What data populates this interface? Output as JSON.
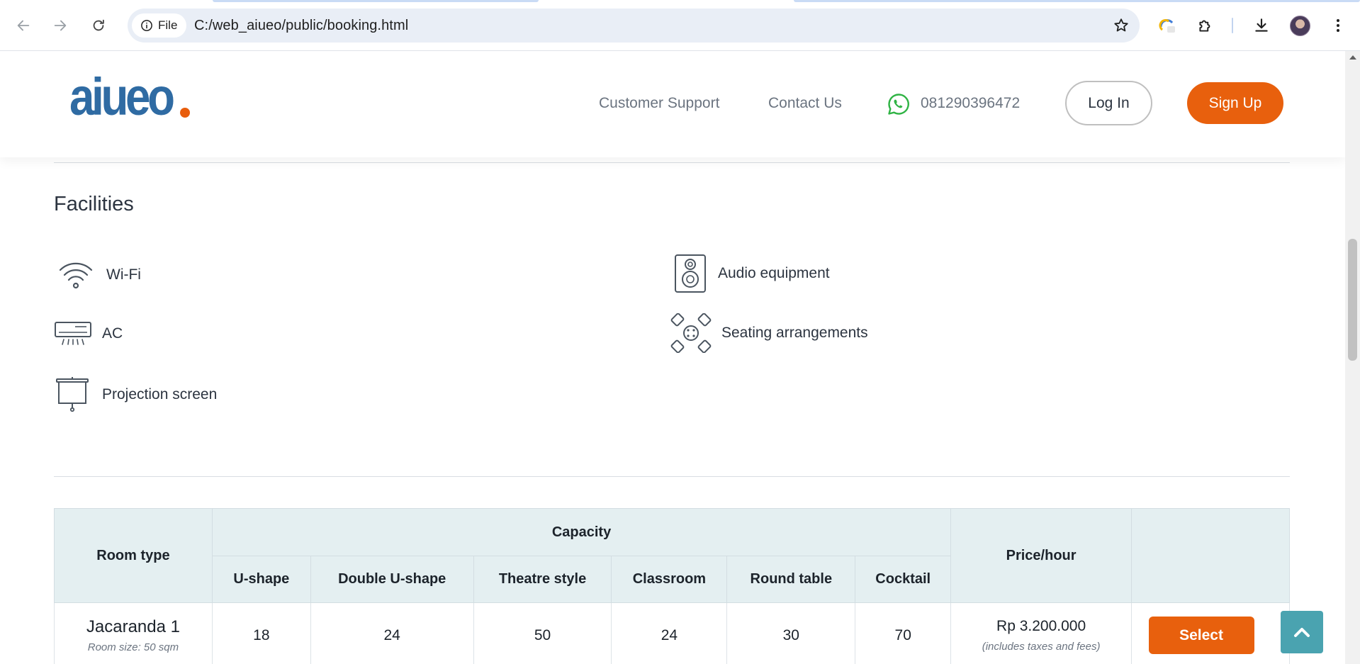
{
  "browser": {
    "file_chip": "File",
    "url": "C:/web_aiueo/public/booking.html"
  },
  "header": {
    "logo_text": "aiueo",
    "nav": {
      "customer_support": "Customer Support",
      "contact_us": "Contact Us"
    },
    "phone": "081290396472",
    "login_label": "Log In",
    "signup_label": "Sign Up"
  },
  "facilities": {
    "title": "Facilities",
    "items": [
      {
        "label": "Wi-Fi",
        "icon": "wifi-icon"
      },
      {
        "label": "AC",
        "icon": "air-conditioner-icon"
      },
      {
        "label": "Projection screen",
        "icon": "projection-screen-icon"
      },
      {
        "label": "Audio equipment",
        "icon": "speaker-icon"
      },
      {
        "label": "Seating arrangements",
        "icon": "seating-icon"
      }
    ]
  },
  "table": {
    "headers": {
      "room_type": "Room type",
      "capacity": "Capacity",
      "price": "Price/hour",
      "capacity_columns": [
        "U-shape",
        "Double U-shape",
        "Theatre style",
        "Classroom",
        "Round table",
        "Cocktail"
      ]
    },
    "rows": [
      {
        "name": "Jacaranda 1",
        "size": "Room size: 50 sqm",
        "capacities": [
          "18",
          "24",
          "50",
          "24",
          "30",
          "70"
        ],
        "price": "Rp 3.200.000",
        "price_note": "(includes taxes and fees)",
        "select_label": "Select"
      }
    ]
  },
  "colors": {
    "brand_blue": "#2f6ba3",
    "brand_orange": "#e8600d",
    "table_header_bg": "#e4eff1",
    "back_to_top": "#4aa3b0"
  }
}
